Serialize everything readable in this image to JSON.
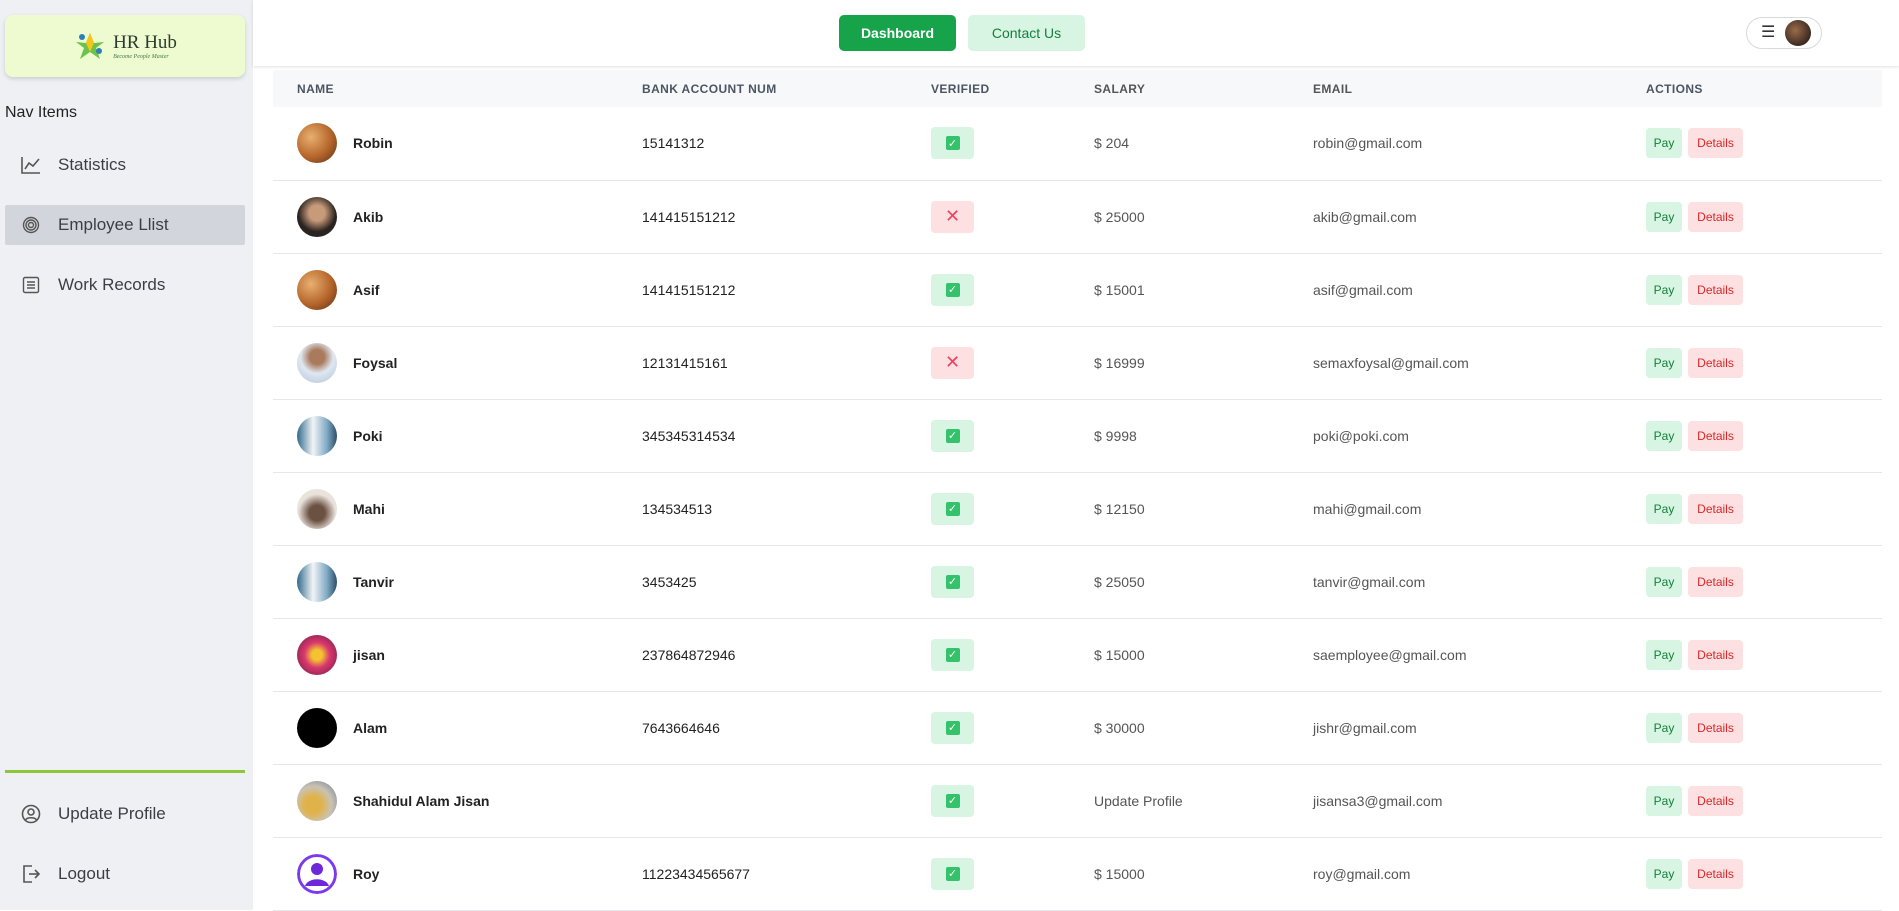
{
  "logo": {
    "title": "HR Hub",
    "tagline": "Become People Master"
  },
  "nav": {
    "heading": "Nav Items",
    "items": [
      {
        "label": "Statistics",
        "icon": "chart-line-icon"
      },
      {
        "label": "Employee Llist",
        "icon": "fingerprint-icon",
        "active": true
      },
      {
        "label": "Work Records",
        "icon": "list-icon"
      }
    ],
    "bottom_items": [
      {
        "label": "Update Profile",
        "icon": "user-circle-icon"
      },
      {
        "label": "Logout",
        "icon": "logout-icon"
      }
    ]
  },
  "header": {
    "dashboard_label": "Dashboard",
    "contact_label": "Contact Us"
  },
  "table": {
    "columns": [
      "NAME",
      "BANK ACCOUNT NUM",
      "VERIFIED",
      "SALARY",
      "EMAIL",
      "ACTIONS"
    ],
    "pay_label": "Pay",
    "details_label": "Details",
    "rows": [
      {
        "name": "Robin",
        "bank": "15141312",
        "verified": true,
        "salary": "$ 204",
        "email": "robin@gmail.com",
        "avatar": "food"
      },
      {
        "name": "Akib",
        "bank": "141415151212",
        "verified": false,
        "salary": "$ 25000",
        "email": "akib@gmail.com",
        "avatar": "woman"
      },
      {
        "name": "Asif",
        "bank": "141415151212",
        "verified": true,
        "salary": "$ 15001",
        "email": "asif@gmail.com",
        "avatar": "food"
      },
      {
        "name": "Foysal",
        "bank": "12131415161",
        "verified": false,
        "salary": "$ 16999",
        "email": "semaxfoysal@gmail.com",
        "avatar": "man-light"
      },
      {
        "name": "Poki",
        "bank": "345345314534",
        "verified": true,
        "salary": "$ 9998",
        "email": "poki@poki.com",
        "avatar": "man-blue"
      },
      {
        "name": "Mahi",
        "bank": "134534513",
        "verified": true,
        "salary": "$ 12150",
        "email": "mahi@gmail.com",
        "avatar": "room"
      },
      {
        "name": "Tanvir",
        "bank": "3453425",
        "verified": true,
        "salary": "$ 25050",
        "email": "tanvir@gmail.com",
        "avatar": "man-blue"
      },
      {
        "name": "jisan",
        "bank": "237864872946",
        "verified": true,
        "salary": "$ 15000",
        "email": "saemployee@gmail.com",
        "avatar": "pink"
      },
      {
        "name": "Alam",
        "bank": "7643664646",
        "verified": true,
        "salary": "$ 30000",
        "email": "jishr@gmail.com",
        "avatar": "black"
      },
      {
        "name": "Shahidul Alam Jisan",
        "bank": "",
        "verified": true,
        "salary": "Update Profile",
        "email": "jisansa3@gmail.com",
        "avatar": "car"
      },
      {
        "name": "Roy",
        "bank": "11223434565677",
        "verified": true,
        "salary": "$ 15000",
        "email": "roy@gmail.com",
        "avatar": "default-user"
      }
    ]
  }
}
